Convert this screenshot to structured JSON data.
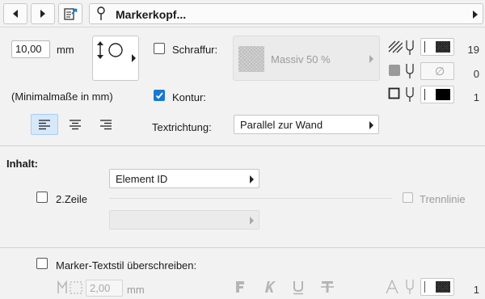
{
  "header": {
    "title": "Markerkopf..."
  },
  "marker": {
    "size_value": "10,00",
    "size_unit": "mm",
    "min_note": "(Minimalmaße in mm)",
    "hatch_label": "Schraffur:",
    "hatch_checked": false,
    "hatch_pattern": "Massiv 50 %",
    "outline_label": "Kontur:",
    "outline_checked": true,
    "text_direction_label": "Textrichtung:",
    "text_direction_value": "Parallel zur Wand",
    "pens": [
      {
        "value": "19",
        "swatch": "hatch"
      },
      {
        "value": "0",
        "swatch": "empty"
      },
      {
        "value": "1",
        "swatch": "black"
      }
    ],
    "empty_symbol": "∅"
  },
  "content": {
    "heading": "Inhalt:",
    "line1_value": "Element ID",
    "line2_label": "2.Zeile",
    "line2_checked": false,
    "separator_label": "Trennlinie",
    "line2_value": ""
  },
  "textstyle": {
    "override_label": "Marker-Textstil überschreiben:",
    "override_checked": false,
    "size_value": "2,00",
    "size_unit": "mm",
    "pen_value": "1"
  }
}
